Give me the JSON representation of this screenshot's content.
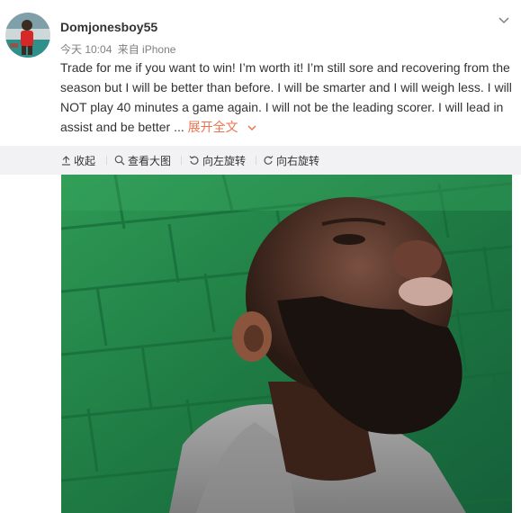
{
  "post": {
    "username": "Domjonesboy55",
    "time": "今天 10:04",
    "source": "来自 iPhone",
    "text": "Trade for me if you want to win! I’m worth it! I’m still sore and recovering from the season but I will be better than before. I will be smarter and I will weigh less. I will NOT play 40 minutes a game again. I will not be the leading scorer. I will lead in assist and be better ... ",
    "expand_label": "展开全文"
  },
  "toolbar": {
    "collapse_label": "收起",
    "view_large_label": "查看大图",
    "rotate_left_label": "向左旋转",
    "rotate_right_label": "向右旋转"
  },
  "colors": {
    "link": "#eb7350",
    "toolbar_bg": "#f2f2f5",
    "wall_green": "#1f7a45"
  },
  "icons": [
    "chevron-down-icon",
    "collapse-up-icon",
    "magnifier-icon",
    "rotate-left-icon",
    "rotate-right-icon"
  ]
}
